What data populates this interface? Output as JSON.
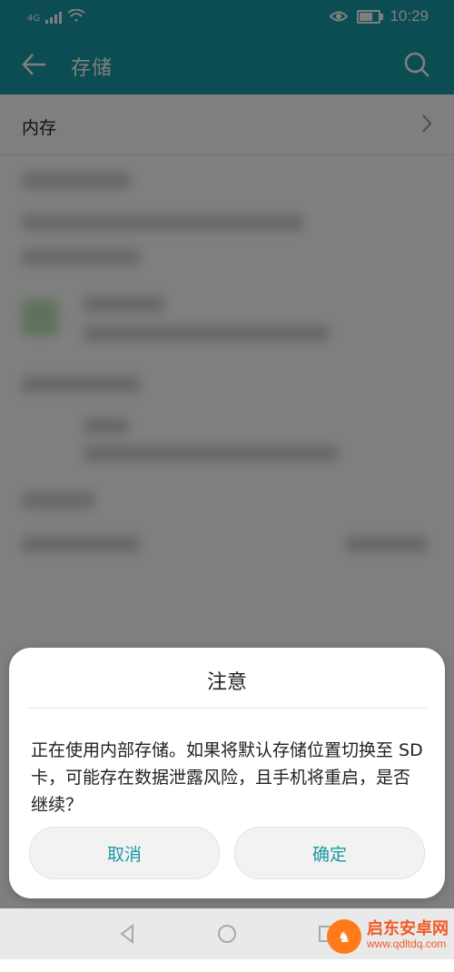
{
  "status_bar": {
    "network": "4G",
    "time": "10:29"
  },
  "app_bar": {
    "title": "存储"
  },
  "list": {
    "internal_storage_label": "内存"
  },
  "dialog": {
    "title": "注意",
    "message": "正在使用内部存储。如果将默认存储位置切换至 SD 卡，可能存在数据泄露风险，且手机将重启，是否继续？",
    "cancel_label": "取消",
    "confirm_label": "确定"
  },
  "watermark": {
    "name": "启东安卓网",
    "url": "www.qdltdq.com"
  },
  "colors": {
    "accent": "#169aa5",
    "button_text": "#1a99a4",
    "dim_overlay": "rgba(0,0,0,0.5)"
  }
}
